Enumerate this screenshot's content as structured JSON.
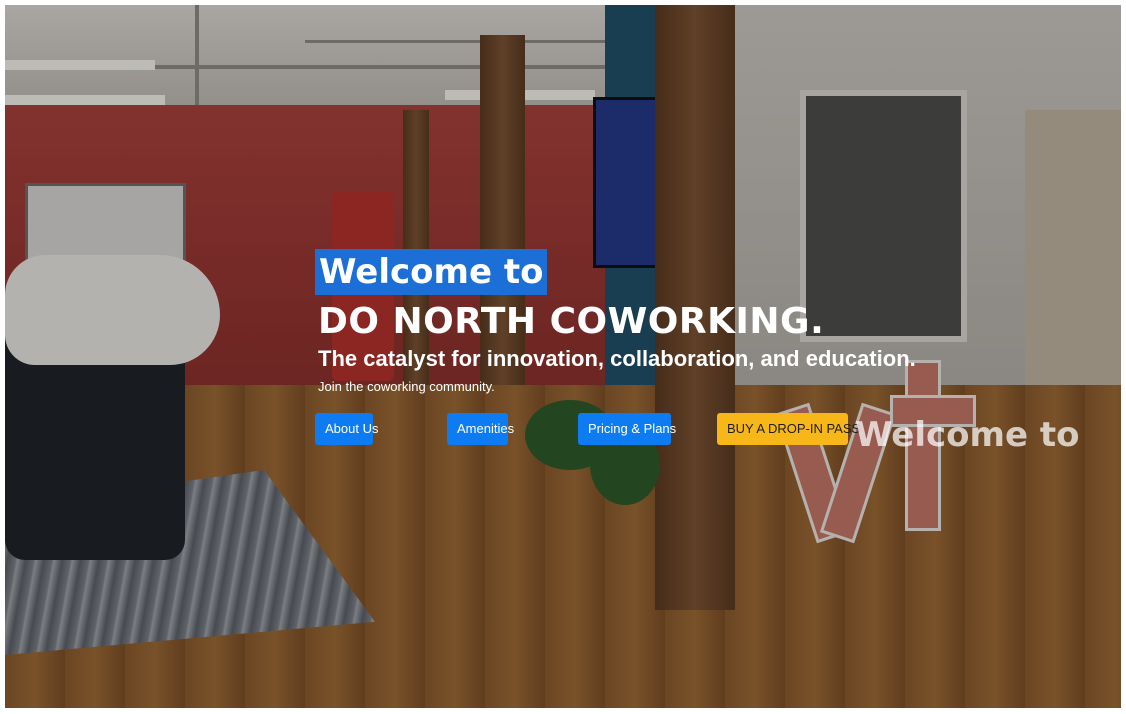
{
  "hero": {
    "welcome": "Welcome to",
    "title": "DO NORTH COWORKING.",
    "subtitle": "The catalyst for innovation, collaboration, and education.",
    "tagline": "Join the coworking community.",
    "ghost_welcome": "Welcome to"
  },
  "buttons": {
    "about": "About Us",
    "amenities": "Amenities",
    "pricing": "Pricing & Plans",
    "drop_in": "BUY A DROP-IN PASS"
  },
  "colors": {
    "highlight": "#1b6fd6",
    "primary_button": "#0d7cf2",
    "warning_button": "#f7b719"
  }
}
